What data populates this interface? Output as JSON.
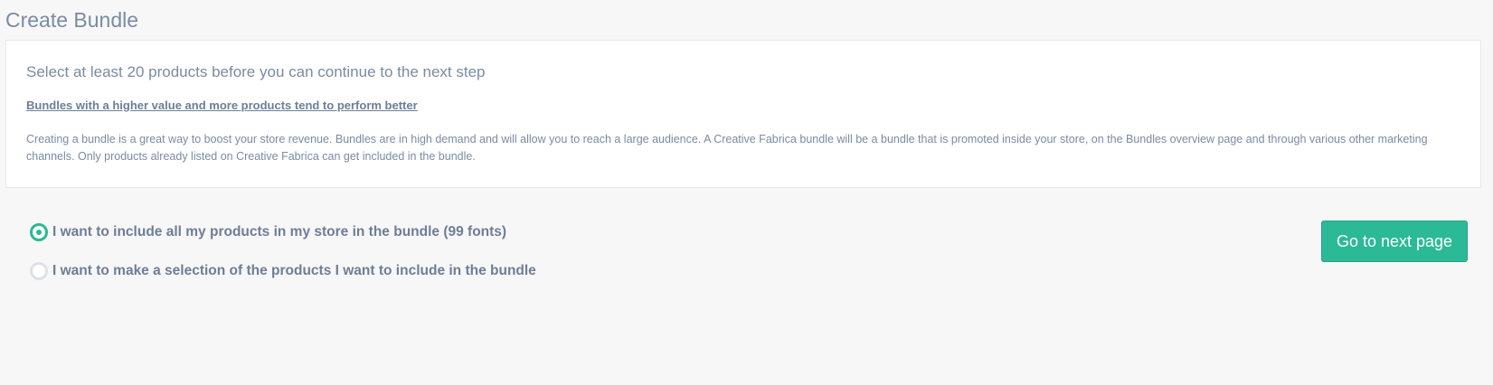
{
  "page": {
    "title": "Create Bundle"
  },
  "info_card": {
    "heading": "Select at least 20 products before you can continue to the next step",
    "tip": "Bundles with a higher value and more products tend to perform better",
    "description": "Creating a bundle is a great way to boost your store revenue. Bundles are in high demand and will allow you to reach a large audience. A Creative Fabrica bundle will be a bundle that is promoted inside your store, on the Bundles overview page and through various other marketing channels. Only products already listed on Creative Fabrica can get included in the bundle."
  },
  "options": {
    "all_products": {
      "label": "I want to include all my products in my store in the bundle (99 fonts)",
      "checked": true
    },
    "selection": {
      "label": "I want to make a selection of the products I want to include in the bundle",
      "checked": false
    }
  },
  "actions": {
    "next_label": "Go to next page"
  },
  "colors": {
    "accent": "#2bb996",
    "text": "#7a8ba3",
    "background": "#f7f7f7",
    "card": "#ffffff",
    "radio_unchecked": "#dde1e5"
  }
}
